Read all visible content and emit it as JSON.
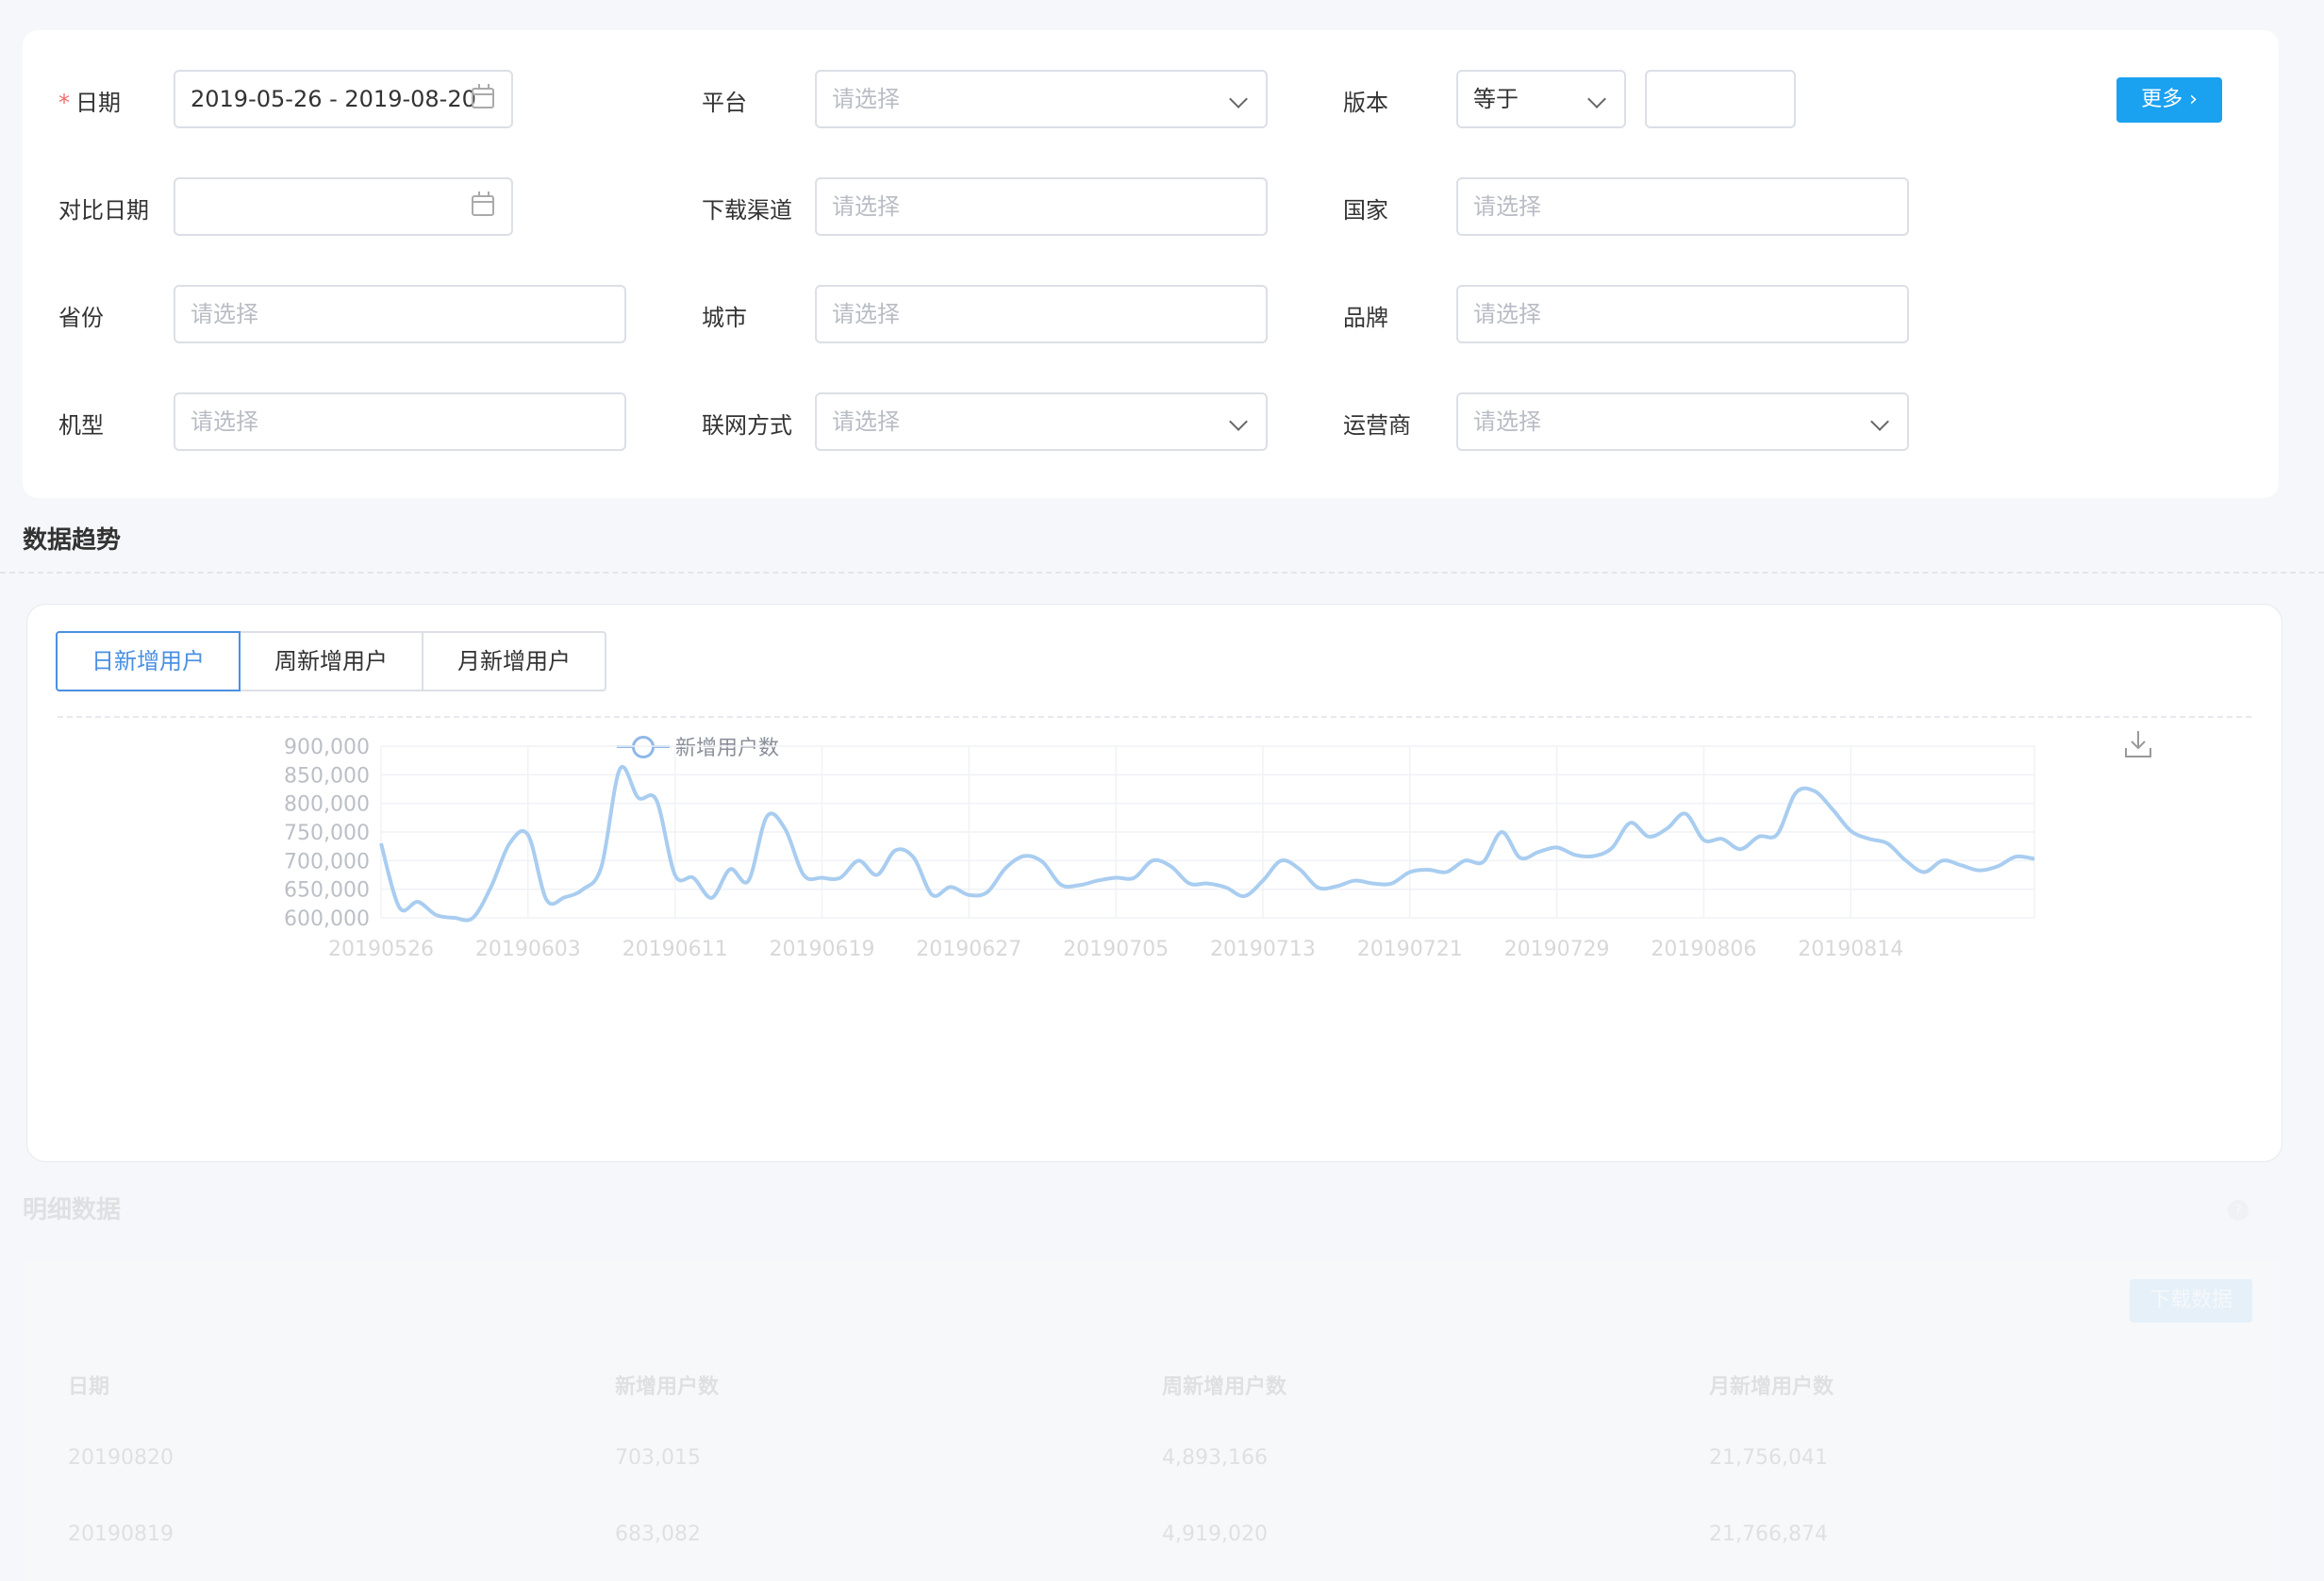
{
  "filters": {
    "date": {
      "label": "日期",
      "required_mark": "*",
      "value": "2019-05-26 - 2019-08-20"
    },
    "platform": {
      "label": "平台",
      "placeholder": "请选择"
    },
    "version": {
      "label": "版本",
      "operator": "等于",
      "value": ""
    },
    "more_button": "更多",
    "compare_date": {
      "label": "对比日期",
      "value": ""
    },
    "channel": {
      "label": "下载渠道",
      "placeholder": "请选择"
    },
    "country": {
      "label": "国家",
      "placeholder": "请选择"
    },
    "province": {
      "label": "省份",
      "placeholder": "请选择"
    },
    "city": {
      "label": "城市",
      "placeholder": "请选择"
    },
    "brand": {
      "label": "品牌",
      "placeholder": "请选择"
    },
    "model": {
      "label": "机型",
      "placeholder": "请选择"
    },
    "network": {
      "label": "联网方式",
      "placeholder": "请选择"
    },
    "carrier": {
      "label": "运营商",
      "placeholder": "请选择"
    }
  },
  "trend": {
    "title": "数据趋势",
    "tabs": [
      "日新增用户",
      "周新增用户",
      "月新增用户"
    ],
    "active_tab": 0
  },
  "chart_data": {
    "type": "line",
    "legend": [
      "新增用户数"
    ],
    "ylim": [
      600000,
      900000
    ],
    "yticks": [
      "900,000",
      "850,000",
      "800,000",
      "750,000",
      "700,000",
      "650,000",
      "600,000"
    ],
    "xticks": [
      "20190526",
      "20190603",
      "20190611",
      "20190619",
      "20190627",
      "20190705",
      "20190713",
      "20190721",
      "20190729",
      "20190806",
      "20190814"
    ],
    "series": [
      {
        "name": "新增用户数",
        "color": "#a9cdf0",
        "values": [
          730000,
          618000,
          628000,
          605000,
          600000,
          600000,
          655000,
          730000,
          745000,
          632000,
          636000,
          650000,
          690000,
          860000,
          810000,
          805000,
          675000,
          670000,
          635000,
          685000,
          665000,
          777000,
          755000,
          675000,
          670000,
          670000,
          700000,
          675000,
          718000,
          705000,
          640000,
          654000,
          640000,
          645000,
          687000,
          708000,
          698000,
          658000,
          657000,
          665000,
          670000,
          670000,
          700000,
          690000,
          660000,
          660000,
          653000,
          638000,
          665000,
          700000,
          685000,
          653000,
          655000,
          665000,
          660000,
          660000,
          680000,
          684000,
          680000,
          700000,
          698000,
          750000,
          705000,
          715000,
          723000,
          710000,
          708000,
          722000,
          766000,
          742000,
          756000,
          782000,
          736000,
          738000,
          720000,
          742000,
          746000,
          818000,
          822000,
          790000,
          752000,
          738000,
          730000,
          700000,
          680000,
          700000,
          692000,
          683000,
          690000,
          707000,
          703000
        ]
      }
    ]
  },
  "detail": {
    "title": "明细数据",
    "download_button": "下载数据",
    "headers": [
      "日期",
      "新增用户数",
      "周新增用户数",
      "月新增用户数"
    ],
    "rows": [
      [
        "20190820",
        "703,015",
        "4,893,166",
        "21,756,041"
      ],
      [
        "20190819",
        "683,082",
        "4,919,020",
        "21,766,874"
      ]
    ]
  }
}
